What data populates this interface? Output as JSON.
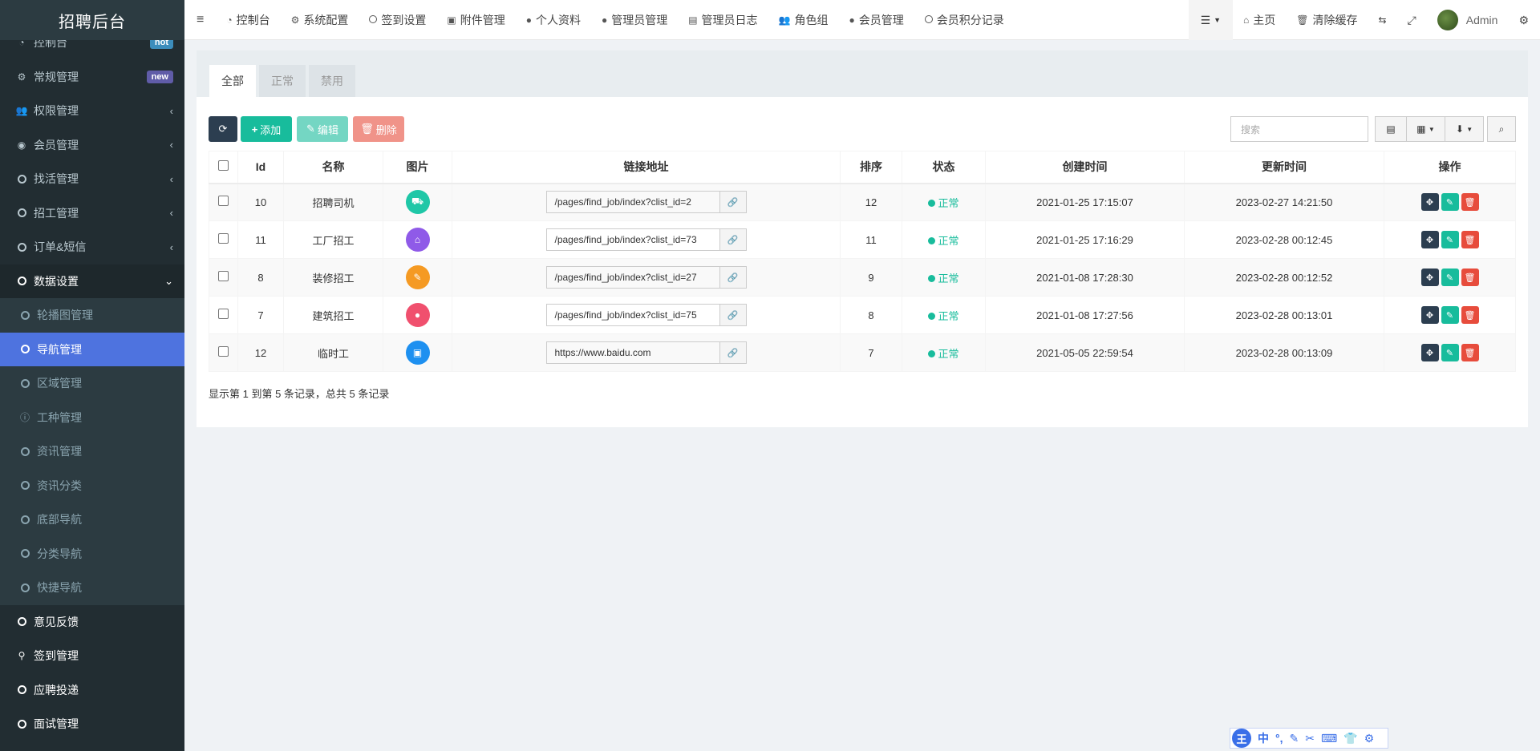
{
  "app": {
    "title": "招聘后台"
  },
  "sidebar": {
    "items": [
      {
        "label": "控制台",
        "icon": "dashboard-icon",
        "badge": "hot"
      },
      {
        "label": "常规管理",
        "icon": "cogs-icon",
        "badge": "new"
      },
      {
        "label": "权限管理",
        "icon": "group-icon",
        "arrow": "‹"
      },
      {
        "label": "会员管理",
        "icon": "user-circle-icon",
        "arrow": "‹"
      },
      {
        "label": "找活管理",
        "icon": "circle-icon",
        "arrow": "‹"
      },
      {
        "label": "招工管理",
        "icon": "circle-icon",
        "arrow": "‹"
      },
      {
        "label": "订单&短信",
        "icon": "circle-icon",
        "arrow": "‹"
      },
      {
        "label": "数据设置",
        "icon": "circle-icon",
        "arrow": "⌄"
      }
    ],
    "subitems": [
      {
        "label": "轮播图管理"
      },
      {
        "label": "导航管理"
      },
      {
        "label": "区域管理"
      },
      {
        "label": "工种管理"
      },
      {
        "label": "资讯管理"
      },
      {
        "label": "资讯分类"
      },
      {
        "label": "底部导航"
      },
      {
        "label": "分类导航"
      },
      {
        "label": "快捷导航"
      }
    ],
    "bottom_items": [
      {
        "label": "意见反馈"
      },
      {
        "label": "签到管理"
      },
      {
        "label": "应聘投递"
      },
      {
        "label": "面试管理"
      }
    ]
  },
  "topnav": {
    "links": [
      {
        "label": "控制台",
        "icon": "dashboard-icon"
      },
      {
        "label": "系统配置",
        "icon": "cog-icon"
      },
      {
        "label": "签到设置",
        "icon": "circle-icon"
      },
      {
        "label": "附件管理",
        "icon": "file-image-icon"
      },
      {
        "label": "个人资料",
        "icon": "user-icon"
      },
      {
        "label": "管理员管理",
        "icon": "user-icon"
      },
      {
        "label": "管理员日志",
        "icon": "list-alt-icon"
      },
      {
        "label": "角色组",
        "icon": "group-icon"
      },
      {
        "label": "会员管理",
        "icon": "user-icon"
      },
      {
        "label": "会员积分记录",
        "icon": "circle-icon"
      }
    ],
    "home": "主页",
    "clear_cache": "清除缓存",
    "admin": "Admin"
  },
  "tabs": [
    {
      "label": "全部"
    },
    {
      "label": "正常"
    },
    {
      "label": "禁用"
    }
  ],
  "toolbar": {
    "add": "添加",
    "edit": "编辑",
    "delete": "删除",
    "search_placeholder": "搜索"
  },
  "table": {
    "headers": [
      "Id",
      "名称",
      "图片",
      "链接地址",
      "排序",
      "状态",
      "创建时间",
      "更新时间",
      "操作"
    ],
    "rows": [
      {
        "id": "10",
        "name": "招聘司机",
        "icon_color": "#1fc7a7",
        "icon": "truck-icon",
        "url": "/pages/find_job/index?clist_id=2",
        "sort": "12",
        "status": "正常",
        "created": "2021-01-25 17:15:07",
        "updated": "2023-02-27 14:21:50"
      },
      {
        "id": "11",
        "name": "工厂招工",
        "icon_color": "#8f5ae8",
        "icon": "factory-icon",
        "url": "/pages/find_job/index?clist_id=73",
        "sort": "11",
        "status": "正常",
        "created": "2021-01-25 17:16:29",
        "updated": "2023-02-28 00:12:45"
      },
      {
        "id": "8",
        "name": "装修招工",
        "icon_color": "#f59a23",
        "icon": "brush-icon",
        "url": "/pages/find_job/index?clist_id=27",
        "sort": "9",
        "status": "正常",
        "created": "2021-01-08 17:28:30",
        "updated": "2023-02-28 00:12:52"
      },
      {
        "id": "7",
        "name": "建筑招工",
        "icon_color": "#f0506e",
        "icon": "drop-icon",
        "url": "/pages/find_job/index?clist_id=75",
        "sort": "8",
        "status": "正常",
        "created": "2021-01-08 17:27:56",
        "updated": "2023-02-28 00:13:01"
      },
      {
        "id": "12",
        "name": "临时工",
        "icon_color": "#1e90f0",
        "icon": "briefcase-icon",
        "url": "https://www.baidu.com",
        "sort": "7",
        "status": "正常",
        "created": "2021-05-05 22:59:54",
        "updated": "2023-02-28 00:13:09"
      }
    ]
  },
  "footer": {
    "info": "显示第 1 到第 5 条记录，总共 5 条记录"
  },
  "ime": {
    "logo": "王",
    "lang": "中"
  }
}
